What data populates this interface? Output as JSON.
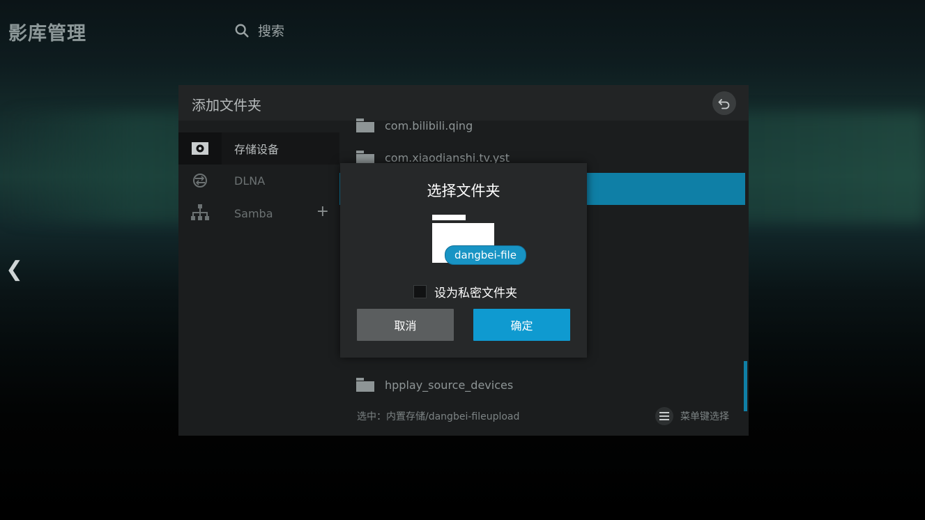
{
  "app": {
    "title": "影库管理",
    "search_label": "搜索"
  },
  "panel": {
    "title": "添加文件夹",
    "sidebar": [
      {
        "label": "存储设备",
        "icon": "storage-device-icon",
        "active": true
      },
      {
        "label": "DLNA",
        "icon": "dlna-icon",
        "active": false
      },
      {
        "label": "Samba",
        "icon": "network-tree-icon",
        "active": false,
        "add": "+"
      }
    ],
    "folders": [
      {
        "name": "com.bilibili.qing"
      },
      {
        "name": "com.xiaodianshi.tv.yst"
      },
      {
        "name": "hpplay_source_devices"
      }
    ],
    "status": "选中：内置存储/dangbei-fileupload",
    "menu_hint": "菜单键选择"
  },
  "dialog": {
    "title": "选择文件夹",
    "folder_name": "dangbei-file",
    "private_checkbox_label": "设为私密文件夹",
    "private_checked": false,
    "cancel_label": "取消",
    "ok_label": "确定"
  },
  "colors": {
    "accent": "#0f9ad0",
    "highlight_row": "#0f7fa6",
    "panel_bg": "#1b1d1e",
    "dialog_bg": "#262829"
  }
}
